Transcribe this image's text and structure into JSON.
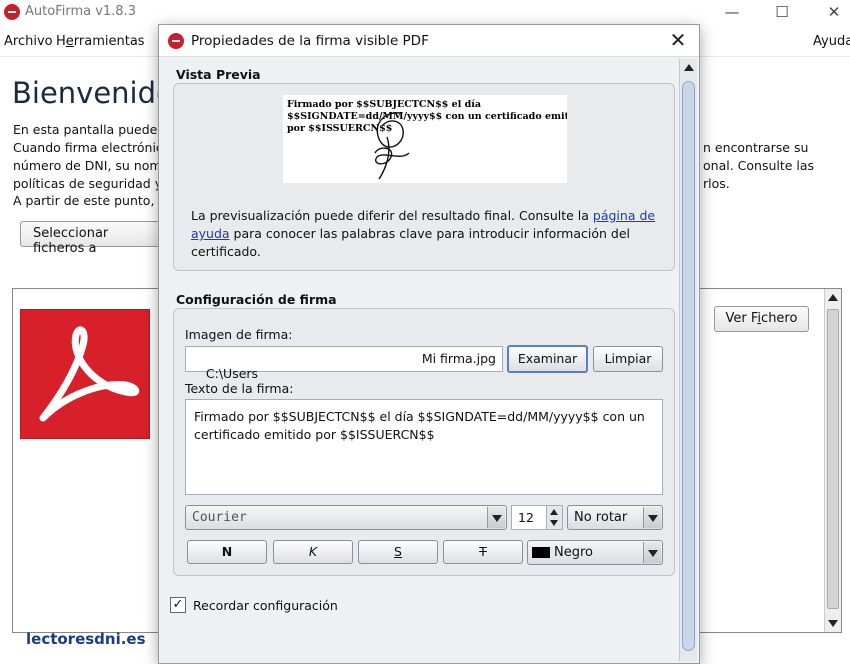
{
  "app": {
    "title": "AutoFirma v1.8.3",
    "window_controls": {
      "minimize": "—",
      "maximize": "☐",
      "close": "✕"
    }
  },
  "menu": {
    "archivo": "Archivo",
    "herramientas_prefix": "H",
    "herramientas_underlined": "e",
    "herramientas_rest": "rramientas",
    "ayuda": "Ayuda"
  },
  "main": {
    "welcome": "Bienvenido",
    "desc": [
      "En esta pantalla puede fi",
      "Cuando firma electrónica",
      "número de DNI, su nomb",
      "políticas de seguridad y p",
      "A partir de este punto, no"
    ],
    "desc_right": [
      "n encontrarse su",
      "onal. Consulte las",
      "rlos."
    ],
    "select_files_button": "Seleccionar ficheros a",
    "view_file_prefix": "Ver F",
    "view_file_underlined": "i",
    "view_file_rest": "chero",
    "watermark": "lectoresdni.es"
  },
  "dialog": {
    "title": "Propiedades de la firma visible PDF",
    "close": "✕",
    "preview": {
      "section_title": "Vista Previa",
      "preview_lines": [
        "Firmado por $$SUBJECTCN$$ el día",
        "$$SIGNDATE=dd/MM/yyyy$$ con un certificado emitido",
        "por $$ISSUERCN$$"
      ],
      "note_before_link": "La previsualización puede diferir del resultado final. Consulte la ",
      "note_link": "página de ayuda",
      "note_after_link": " para conocer las palabras clave para introducir información del certificado."
    },
    "config": {
      "section_title": "Configuración de firma",
      "image_label": "Imagen de firma:",
      "image_path_start": "C:\\Users",
      "image_path_end": "Mi firma.jpg",
      "browse_button": "Examinar",
      "clear_button": "Limpiar",
      "text_label": "Texto de la firma:",
      "signature_text": "Firmado por $$SUBJECTCN$$ el día $$SIGNDATE=dd/MM/yyyy$$ con un certificado emitido por $$ISSUERCN$$",
      "font": "Courier",
      "font_size": "12",
      "rotation": "No rotar",
      "bold": "N",
      "italic": "K",
      "underline": "S",
      "strike": "T",
      "color": "Negro",
      "color_hex": "#000000"
    },
    "remember": {
      "label": "Recordar configuración",
      "checked": "✓"
    }
  }
}
